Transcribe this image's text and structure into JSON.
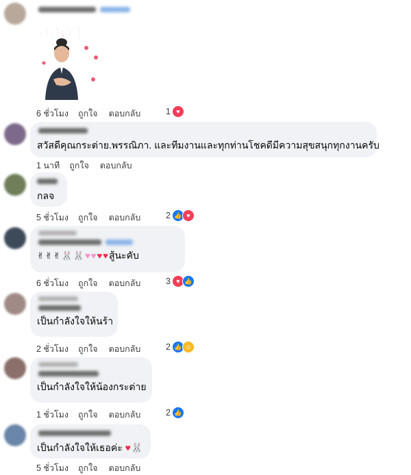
{
  "comments": [
    {
      "text": "",
      "has_sticker": true,
      "sticker": {
        "caption": "กอดๆ"
      },
      "actions": {
        "time": "6 ชั่วโมง",
        "like": "ถูกใจ",
        "reply": "ตอบกลับ"
      },
      "reactions": {
        "count": "1",
        "types": [
          "love"
        ]
      }
    },
    {
      "text": "สวัสดีคุณกระต่าย.พรรณิภา. และทีมงานและทุกท่านโชคดีมีความสุขสนุกทุกงานครับ",
      "actions": {
        "time": "1 นาที",
        "like": "ถูกใจ",
        "reply": "ตอบกลับ"
      },
      "reactions": null
    },
    {
      "text": "กลจ",
      "actions": {
        "time": "5 ชั่วโมง",
        "like": "ถูกใจ",
        "reply": "ตอบกลับ"
      },
      "reactions": {
        "count": "2",
        "types": [
          "like",
          "love"
        ]
      }
    },
    {
      "text": "สู้นะคับ",
      "emojis": "✌✌✌🐰🐰",
      "actions": {
        "time": "6 ชั่วโมง",
        "like": "ถูกใจ",
        "reply": "ตอบกลับ"
      },
      "reactions": {
        "count": "3",
        "types": [
          "love",
          "like"
        ]
      }
    },
    {
      "text": "เป็นกำลังใจให้นร้า",
      "actions": {
        "time": "2 ชั่วโมง",
        "like": "ถูกใจ",
        "reply": "ตอบกลับ"
      },
      "reactions": {
        "count": "2",
        "types": [
          "like",
          "care"
        ]
      }
    },
    {
      "text": "เป็นกำลังใจให้น้องกระต่าย",
      "actions": {
        "time": "2 ชั่วโมง",
        "like": "ถูกใจ",
        "reply": "ตอบกลับ"
      },
      "reactions": null
    },
    {
      "text": "เป็นกำลังใจให้น้องกระต่าย",
      "actions": {
        "time": "1 ชั่วโมง",
        "like": "ถูกใจ",
        "reply": "ตอบกลับ"
      },
      "reactions": {
        "count": "2",
        "types": [
          "like"
        ]
      }
    },
    {
      "text": "เป็นกำลังใจให้เธอค่ะ",
      "actions": {
        "time": "5 ชั่วโมง",
        "like": "ถูกใจ",
        "reply": "ตอบกลับ"
      },
      "reactions": null
    }
  ],
  "colors": {
    "bubble": "#f0f2f5",
    "like": "#1877f2",
    "love": "#f33e58",
    "care": "#f7b928"
  }
}
